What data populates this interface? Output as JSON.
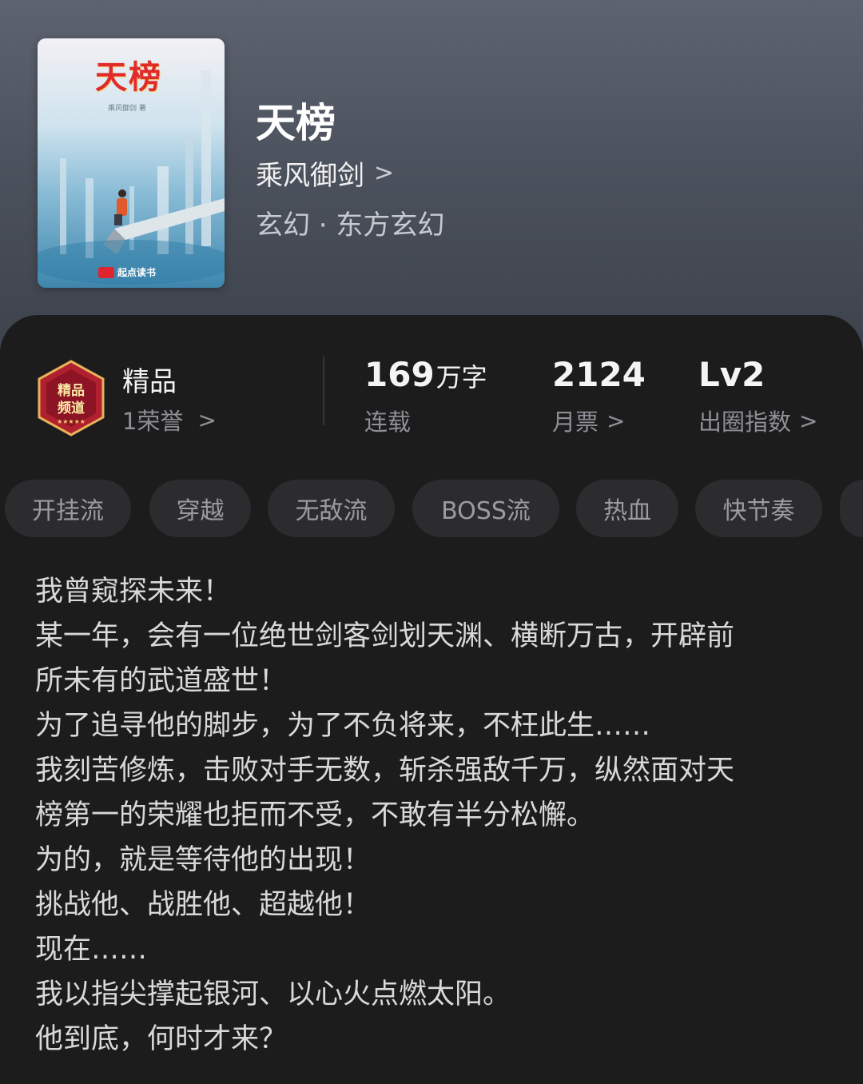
{
  "book": {
    "title": "天榜",
    "author": "乘风御剑",
    "genre": "玄幻 · 东方玄幻",
    "cover": {
      "title": "天榜",
      "author_line": "乘风御剑 著",
      "brand": "起点读书"
    }
  },
  "honor": {
    "badge_text": "精品频道",
    "title": "精品",
    "subtitle": "1荣誉"
  },
  "stats": [
    {
      "value": "169",
      "unit": "万字",
      "label": "连载",
      "has_arrow": false
    },
    {
      "value": "2124",
      "unit": "",
      "label": "月票",
      "has_arrow": true
    },
    {
      "value": "Lv2",
      "unit": "",
      "label": "出圈指数",
      "has_arrow": true
    }
  ],
  "tags": [
    "开挂流",
    "穿越",
    "无敌流",
    "BOSS流",
    "热血",
    "快节奏"
  ],
  "synopsis": [
    "我曾窥探未来！",
    "某一年，会有一位绝世剑客剑划天渊、横断万古，开辟前",
    "所未有的武道盛世！",
    "为了追寻他的脚步，为了不负将来，不枉此生……",
    "我刻苦修炼，击败对手无数，斩杀强敌千万，纵然面对天",
    "榜第一的荣耀也拒而不受，不敢有半分松懈。",
    "为的，就是等待他的出现！",
    "挑战他、战胜他、超越他！",
    "现在……",
    "我以指尖撑起银河、以心火点燃太阳。",
    "他到底，何时才来？"
  ],
  "icons": {
    "chevron": "chevron-right-icon",
    "badge": "premium-channel-badge-icon"
  },
  "colors": {
    "header_bg": "#4c525d",
    "panel_bg": "#1c1c1d",
    "tag_bg": "#2c2c2e",
    "cover_title": "#e02b2b"
  }
}
